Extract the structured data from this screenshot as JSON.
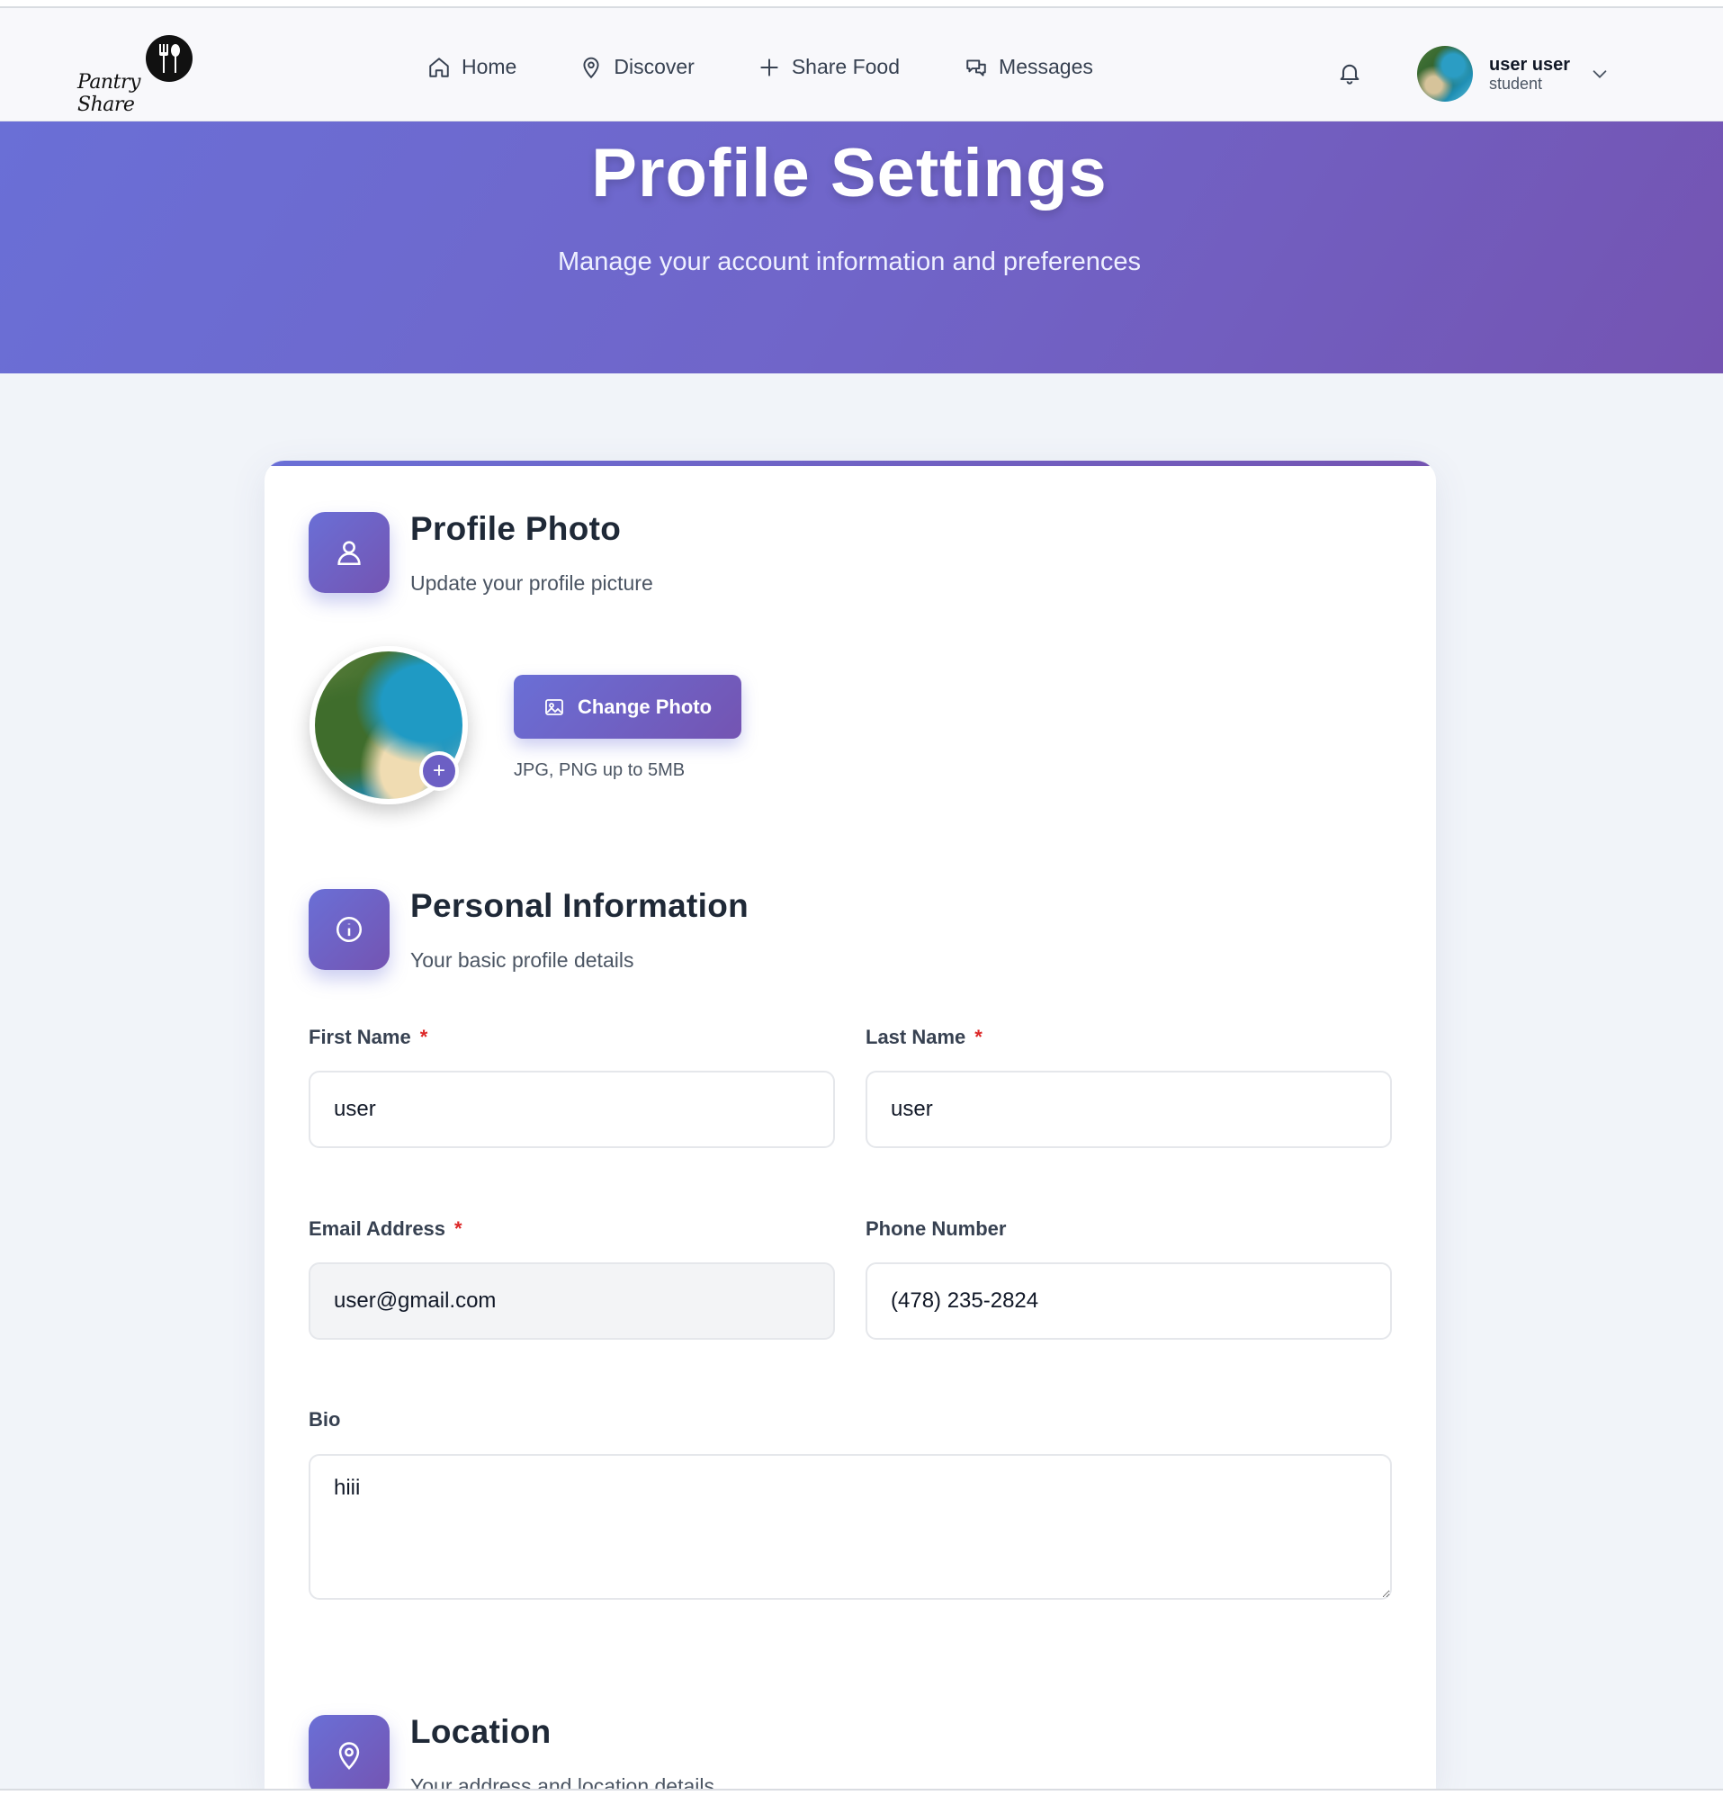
{
  "brand": {
    "logo_text": "Pantry Share"
  },
  "nav": {
    "home": "Home",
    "discover": "Discover",
    "share_food": "Share Food",
    "messages": "Messages"
  },
  "user": {
    "name": "user user",
    "role": "student"
  },
  "hero": {
    "title": "Profile Settings",
    "subtitle": "Manage your account information and preferences"
  },
  "profile_photo": {
    "title": "Profile Photo",
    "subtitle": "Update your profile picture",
    "button_label": "Change Photo",
    "hint": "JPG, PNG up to 5MB",
    "plus": "+"
  },
  "personal_info": {
    "title": "Personal Information",
    "subtitle": "Your basic profile details",
    "first_name": {
      "label": "First Name",
      "value": "user",
      "required": "*"
    },
    "last_name": {
      "label": "Last Name",
      "value": "user",
      "required": "*"
    },
    "email": {
      "label": "Email Address",
      "value": "user@gmail.com",
      "required": "*"
    },
    "phone": {
      "label": "Phone Number",
      "value": "(478) 235-2824"
    },
    "bio": {
      "label": "Bio",
      "value": "hiii"
    }
  },
  "location": {
    "title": "Location",
    "subtitle": "Your address and location details"
  },
  "colors": {
    "accent_start": "#6a6fd6",
    "accent_end": "#7454b2",
    "required": "#dc2626"
  },
  "icons": {
    "nav_home": "home-icon",
    "nav_discover": "map-pin-icon",
    "nav_share": "plus-icon",
    "nav_messages": "chat-bubbles-icon",
    "notifications": "bell-icon",
    "user_menu": "chevron-down-icon",
    "profile_section": "user-icon",
    "personal_section": "info-icon",
    "location_section": "map-pin-icon",
    "change_photo": "image-icon"
  }
}
